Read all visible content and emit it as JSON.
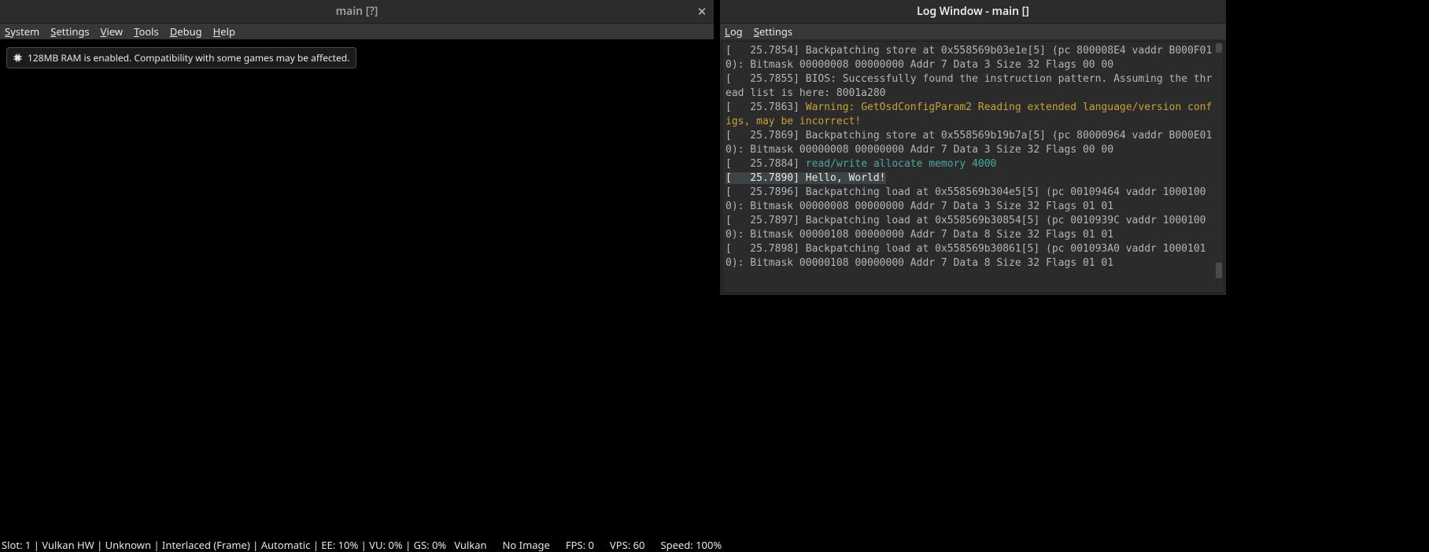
{
  "main": {
    "title": "main [?]",
    "menu": {
      "system": "System",
      "settings": "Settings",
      "view": "View",
      "tools": "Tools",
      "debug": "Debug",
      "help": "Help"
    },
    "toast": "128MB RAM is enabled. Compatibility with some games may be affected.",
    "status": {
      "left": "Slot: 1 | Vulkan HW | Unknown | Interlaced (Frame) | Automatic | EE: 10% | VU: 0% | GS: 0%",
      "renderer": "Vulkan",
      "image": "No Image",
      "fps": "FPS: 0",
      "vps": "VPS: 60",
      "speed": "Speed: 100%"
    }
  },
  "log": {
    "title": "Log Window - main []",
    "menu": {
      "log": "Log",
      "settings": "Settings"
    },
    "lines": [
      {
        "level": "info",
        "text": "[   25.7854] Backpatching store at 0x558569b03e1e[5] (pc 800008E4 vaddr B000F010): Bitmask 00000008 00000000 Addr 7 Data 3 Size 32 Flags 00 00"
      },
      {
        "level": "info",
        "text": "[   25.7855] BIOS: Successfully found the instruction pattern. Assuming the thread list is here: 8001a280"
      },
      {
        "level": "info",
        "prefix": "[   25.7863] ",
        "text": "Warning: GetOsdConfigParam2 Reading extended language/version configs, may be incorrect!",
        "warn": true
      },
      {
        "level": "info",
        "text": "[   25.7869] Backpatching store at 0x558569b19b7a[5] (pc 80000964 vaddr B000E010): Bitmask 00000008 00000000 Addr 7 Data 3 Size 32 Flags 00 00"
      },
      {
        "level": "info",
        "prefix": "[   25.7884] ",
        "text": "read/write allocate memory 4000",
        "teal": true
      },
      {
        "level": "hl",
        "text": "[   25.7890] Hello, World!"
      },
      {
        "level": "info",
        "text": "[   25.7896] Backpatching load at 0x558569b304e5[5] (pc 00109464 vaddr 10001000): Bitmask 00000008 00000000 Addr 7 Data 3 Size 32 Flags 01 01"
      },
      {
        "level": "info",
        "text": "[   25.7897] Backpatching load at 0x558569b30854[5] (pc 0010939C vaddr 10001000): Bitmask 00000108 00000000 Addr 7 Data 8 Size 32 Flags 01 01"
      },
      {
        "level": "info",
        "text": "[   25.7898] Backpatching load at 0x558569b30861[5] (pc 001093A0 vaddr 10001010): Bitmask 00000108 00000000 Addr 7 Data 8 Size 32 Flags 01 01"
      }
    ]
  }
}
